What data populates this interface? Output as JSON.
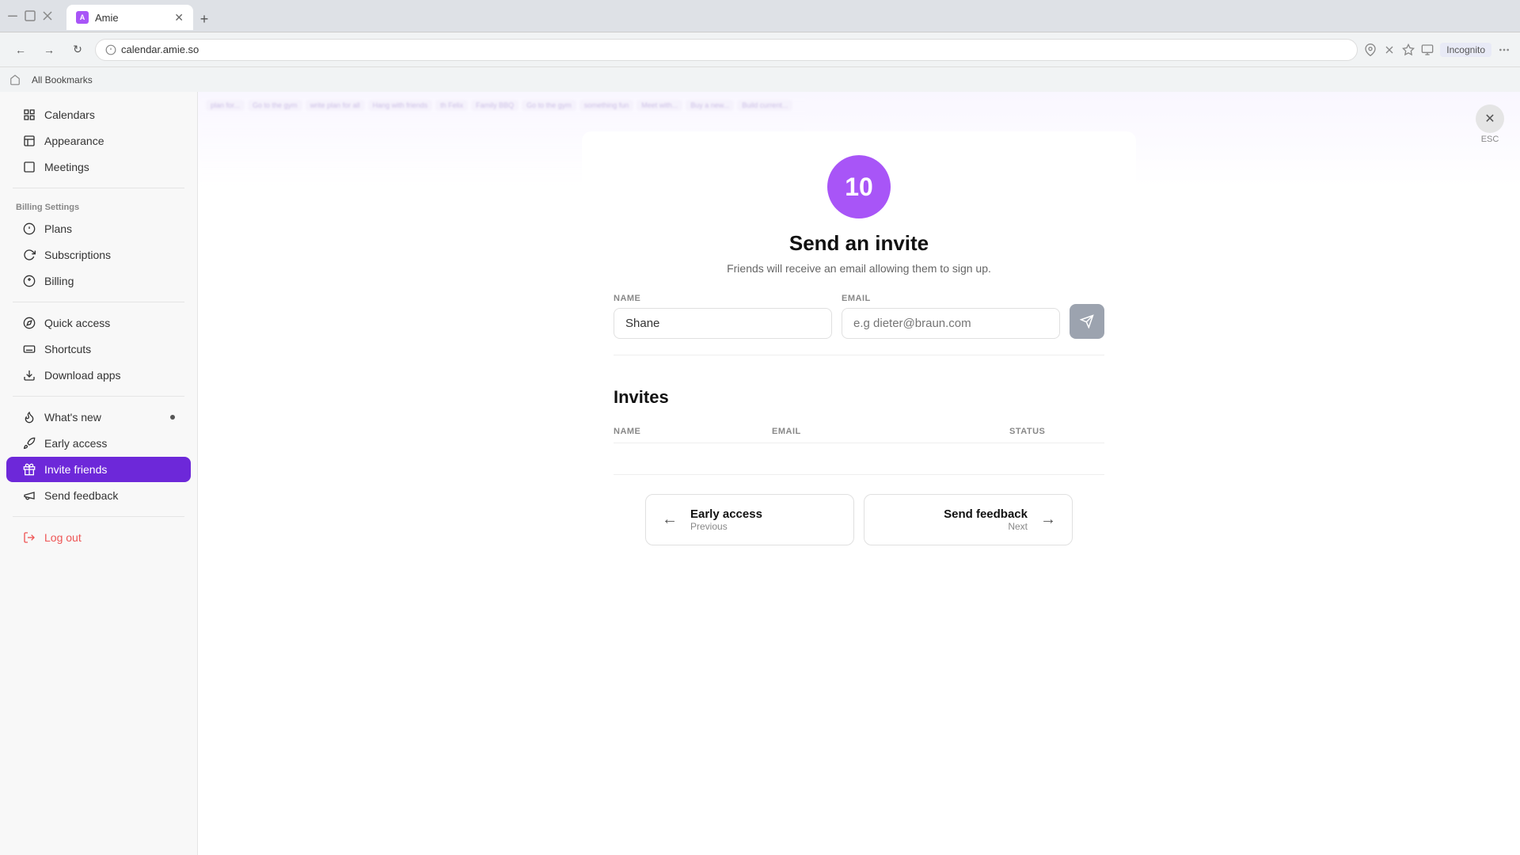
{
  "browser": {
    "tab_title": "Amie",
    "tab_favicon": "A",
    "url": "calendar.amie.so",
    "new_tab_label": "+",
    "incognito_label": "Incognito",
    "bookmarks_label": "All Bookmarks",
    "nav": {
      "back": "←",
      "forward": "→",
      "reload": "↻"
    }
  },
  "sidebar": {
    "sections": [
      {
        "label": "",
        "items": [
          {
            "id": "calendars",
            "icon": "grid",
            "label": "Calendars"
          },
          {
            "id": "appearance",
            "icon": "bars",
            "label": "Appearance"
          },
          {
            "id": "meetings",
            "icon": "square",
            "label": "Meetings"
          }
        ]
      },
      {
        "label": "Billing Settings",
        "items": [
          {
            "id": "plans",
            "icon": "circle-dollar",
            "label": "Plans"
          },
          {
            "id": "subscriptions",
            "icon": "refresh-dollar",
            "label": "Subscriptions"
          },
          {
            "id": "billing",
            "icon": "dollar",
            "label": "Billing"
          }
        ]
      },
      {
        "label": "",
        "items": [
          {
            "id": "quick-access",
            "icon": "compass",
            "label": "Quick access"
          },
          {
            "id": "shortcuts",
            "icon": "keyboard",
            "label": "Shortcuts"
          },
          {
            "id": "download-apps",
            "icon": "download",
            "label": "Download apps"
          }
        ]
      },
      {
        "label": "",
        "items": [
          {
            "id": "whats-new",
            "icon": "flame",
            "label": "What's new",
            "dot": true
          },
          {
            "id": "early-access",
            "icon": "rocket",
            "label": "Early access"
          },
          {
            "id": "invite-friends",
            "icon": "gift",
            "label": "Invite friends",
            "active": true
          },
          {
            "id": "send-feedback",
            "icon": "megaphone",
            "label": "Send feedback"
          }
        ]
      }
    ],
    "logout_label": "Log out"
  },
  "main": {
    "avatar_number": "10",
    "card_title": "Send an invite",
    "card_subtitle": "Friends will receive an email allowing them to sign up.",
    "form": {
      "name_label": "NAME",
      "name_value": "Shane",
      "email_label": "EMAIL",
      "email_placeholder": "e.g dieter@braun.com"
    },
    "invites_section": {
      "title": "Invites",
      "columns": [
        {
          "id": "name",
          "label": "NAME"
        },
        {
          "id": "email",
          "label": "EMAIL"
        },
        {
          "id": "status",
          "label": "STATUS"
        }
      ]
    },
    "nav_footer": {
      "prev_title": "Early access",
      "prev_sub": "Previous",
      "next_title": "Send feedback",
      "next_sub": "Next"
    },
    "esc_label": "ESC"
  },
  "calendar_chips": [
    "plan for...",
    "Go to the gym",
    "write plan for all",
    "Hang with friends",
    "th Felix",
    "Family BBQ",
    "Go to the gym",
    "something fun",
    "Meet with...",
    "Buy a new...",
    "Build current..."
  ]
}
